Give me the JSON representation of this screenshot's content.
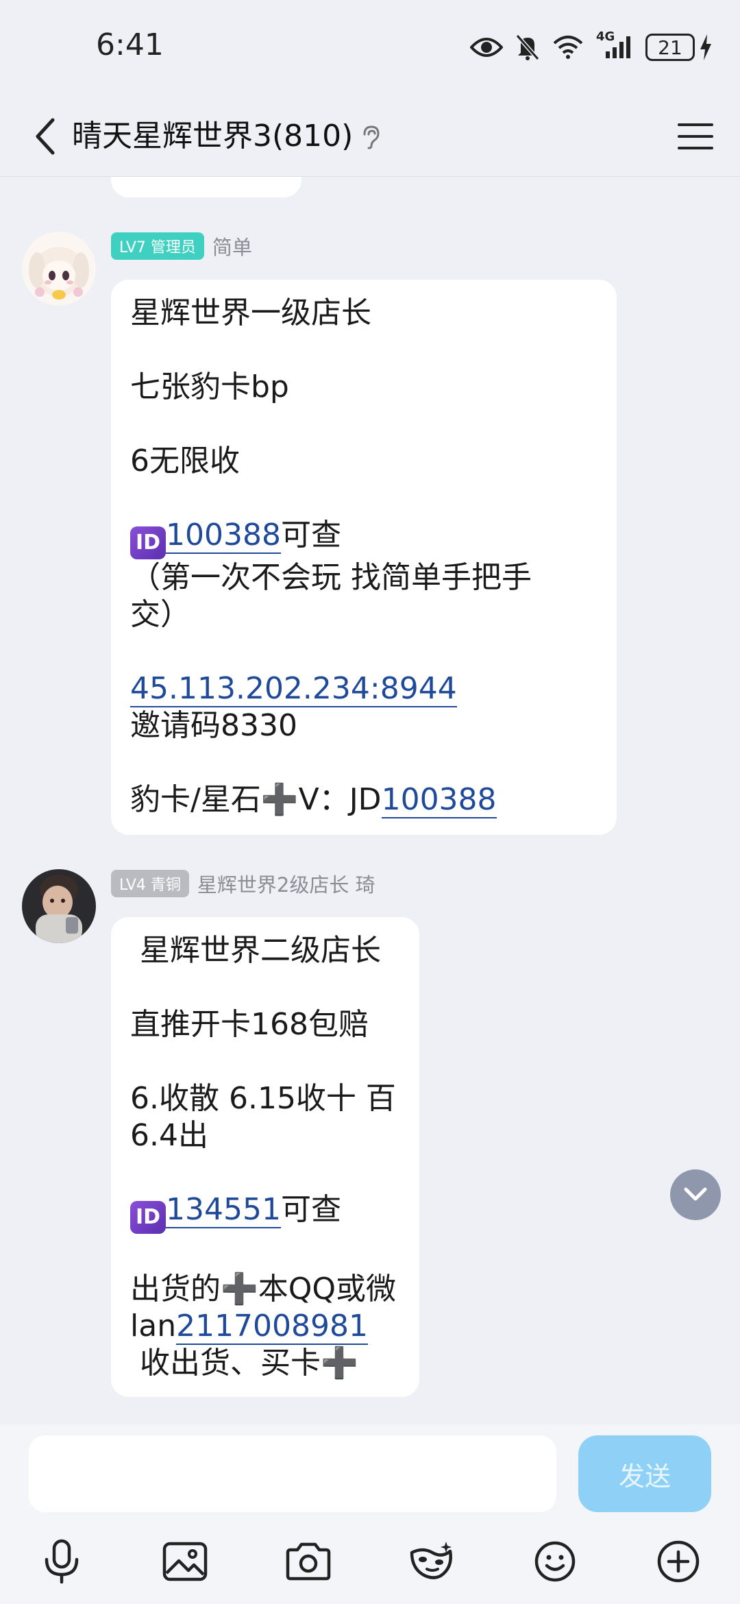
{
  "status": {
    "time": "6:41",
    "network": "4G",
    "battery": "21"
  },
  "header": {
    "title": "晴天星辉世界3(810)"
  },
  "messages": [
    {
      "badge": "LV7 管理员",
      "badge_color": "#3fd0c1",
      "sender": "简单",
      "lines": {
        "l1": "星辉世界一级店长",
        "l2": "七张豹卡bp",
        "l3": "6无限收",
        "id_badge": "ID",
        "id_link": "100388",
        "id_suffix": "可查",
        "l5": "（第一次不会玩 找简单手把手",
        "l6": "交）",
        "ip_link": "45.113.202.234:8944",
        "l8": "邀请码8330",
        "l9_prefix": "豹卡/星石➕V：JD",
        "l9_link": "100388"
      }
    },
    {
      "badge": "LV4 青铜",
      "badge_color": "#b9bbc1",
      "sender": "星辉世界2级店长 琦",
      "lines": {
        "l1": " 星辉世界二级店长",
        "l2": "直推开卡168包赔",
        "l3": "6.收散 6.15收十 百",
        "l4": "6.4出",
        "id_badge": "ID",
        "id_link": "134551",
        "id_suffix": "可查",
        "l6": "出货的➕本QQ或微",
        "l7_prefix": "lan",
        "l7_link": "2117008981",
        "l8": " 收出货、买卡➕"
      }
    }
  ],
  "input": {
    "value": "",
    "send_label": "发送"
  }
}
